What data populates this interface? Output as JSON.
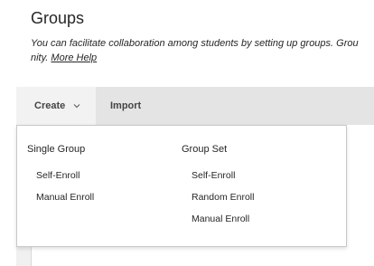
{
  "page": {
    "title": "Groups",
    "description_line1": "You can facilitate collaboration among students by setting up groups. Grou",
    "description_line2_prefix": "nity.",
    "help_link": "More Help"
  },
  "toolbar": {
    "create_label": "Create",
    "import_label": "Import"
  },
  "dropdown": {
    "single_group": {
      "header": "Single Group",
      "items": [
        "Self-Enroll",
        "Manual Enroll"
      ]
    },
    "group_set": {
      "header": "Group Set",
      "items": [
        "Self-Enroll",
        "Random Enroll",
        "Manual Enroll"
      ]
    }
  },
  "colors": {
    "toolbar_bg": "#e4e4e4",
    "create_tab_bg": "#f2f2f2",
    "text": "#262626"
  }
}
